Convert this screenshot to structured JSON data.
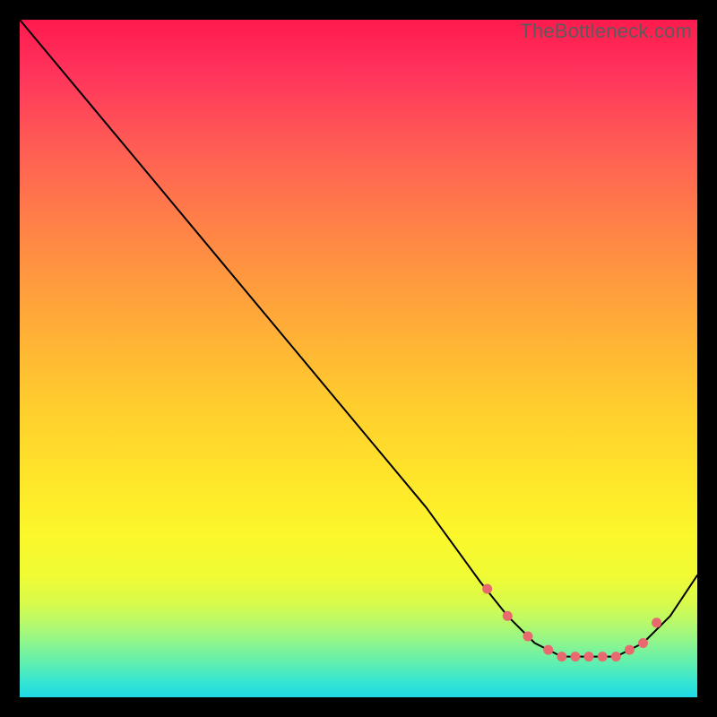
{
  "watermark": "TheBottleneck.com",
  "colors": {
    "marker": "#e86a6f",
    "line": "#000000",
    "frame_bg": "#000000"
  },
  "chart_data": {
    "type": "line",
    "title": "",
    "xlabel": "",
    "ylabel": "",
    "xlim": [
      0,
      100
    ],
    "ylim": [
      0,
      100
    ],
    "x": [
      0,
      5,
      10,
      20,
      30,
      40,
      50,
      60,
      68,
      72,
      76,
      80,
      84,
      88,
      92,
      96,
      100
    ],
    "values": [
      100,
      94,
      88,
      76,
      64,
      52,
      40,
      28,
      17,
      12,
      8,
      6,
      6,
      6,
      8,
      12,
      18
    ],
    "markers_x": [
      69,
      72,
      75,
      78,
      80,
      82,
      84,
      86,
      88,
      90,
      92,
      94
    ],
    "markers_y": [
      16,
      12,
      9,
      7,
      6,
      6,
      6,
      6,
      6,
      7,
      8,
      11
    ]
  }
}
